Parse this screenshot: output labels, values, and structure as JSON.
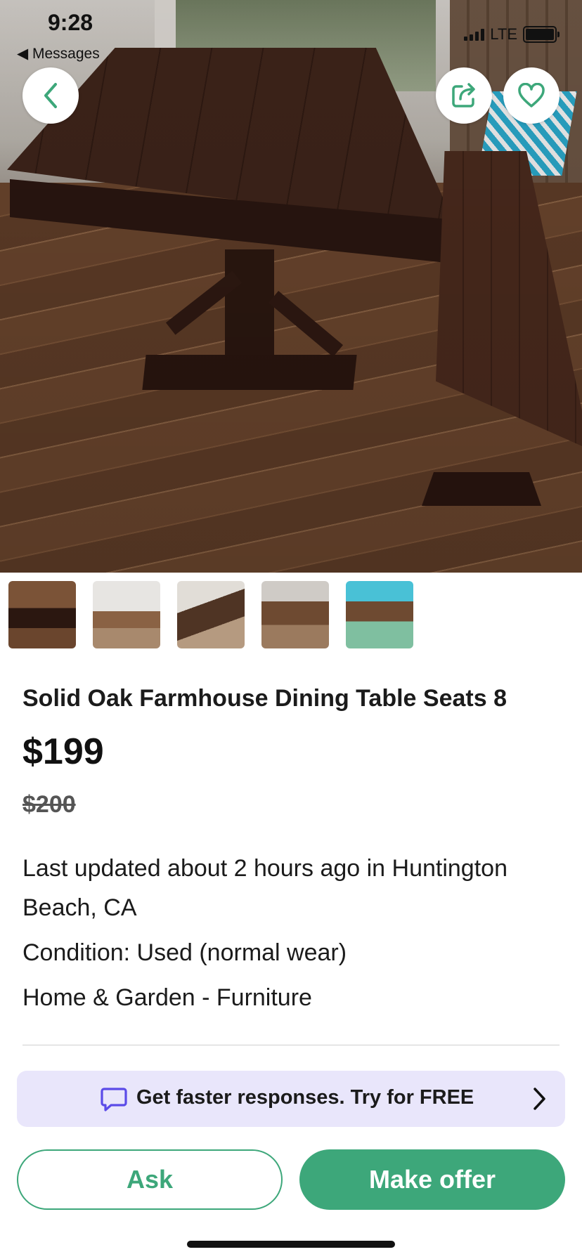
{
  "status_bar": {
    "time": "9:28",
    "back_app": "◀ Messages",
    "network": "LTE"
  },
  "hero": {
    "back_icon": "chevron-left-icon",
    "share_icon": "share-icon",
    "favorite_icon": "heart-icon"
  },
  "listing": {
    "title": "Solid Oak Farmhouse Dining Table Seats 8",
    "price": "$199",
    "original_price": "$200",
    "updated": "Last updated about 2 hours ago in Huntington Beach, CA",
    "condition": "Condition: Used (normal wear)",
    "category": "Home & Garden - Furniture"
  },
  "promo": {
    "text": "Get faster responses.  Try for FREE"
  },
  "actions": {
    "ask_label": "Ask",
    "offer_label": "Make offer"
  },
  "colors": {
    "accent": "#3da77a",
    "promo_bg": "#e9e6fb",
    "promo_icon": "#5b4be8"
  }
}
